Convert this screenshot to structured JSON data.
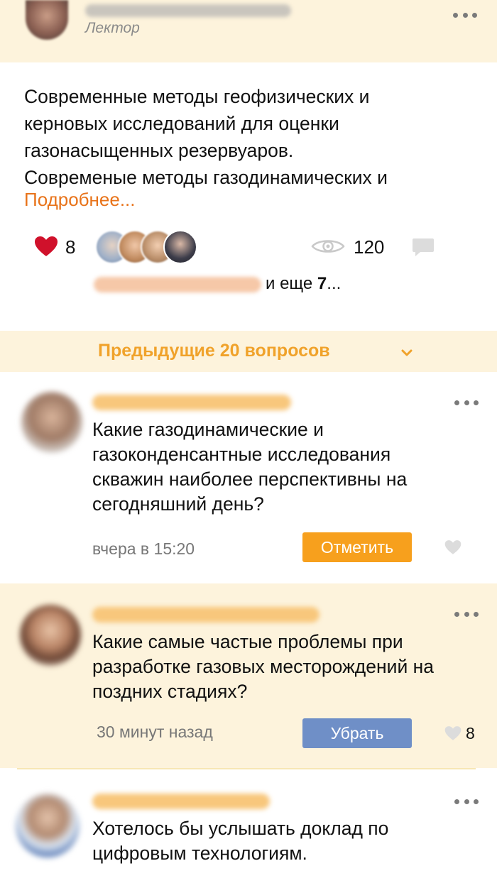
{
  "header": {
    "role": "Лектор"
  },
  "post": {
    "text_lines": [
      "Современные методы геофизических и",
      "керновых исследований для оценки",
      "газонасыщенных резервуаров.",
      "Современые методы газодинамических и"
    ],
    "more_link": "Подробнее...",
    "likes": "8",
    "views": "120",
    "likers_more_prefix": "и еще ",
    "likers_more_count": "7",
    "likers_more_suffix": "..."
  },
  "previous": {
    "label": "Предыдущие 20 вопросов"
  },
  "questions": [
    {
      "text": "Какие газодинамические и газоконденсантные исследования скважин наиболее перспективны на сегодняшний день?",
      "time": "вчера в 15:20",
      "button": "Отметить",
      "likes": ""
    },
    {
      "text": "Какие самые частые проблемы при разработке газовых месторождений на поздних стадиях?",
      "time": "30 минут назад",
      "button": "Убрать",
      "likes": "8"
    },
    {
      "text": "Хотелось бы услышать доклад по цифровым технологиям."
    }
  ],
  "colors": {
    "header_bg": "#fdf3dc",
    "accent_orange": "#f7a01d",
    "link_orange": "#e8731a",
    "button_blue": "#6f8fc7",
    "heart_red": "#d0112b",
    "highlight_bg": "#fdf3dc"
  }
}
